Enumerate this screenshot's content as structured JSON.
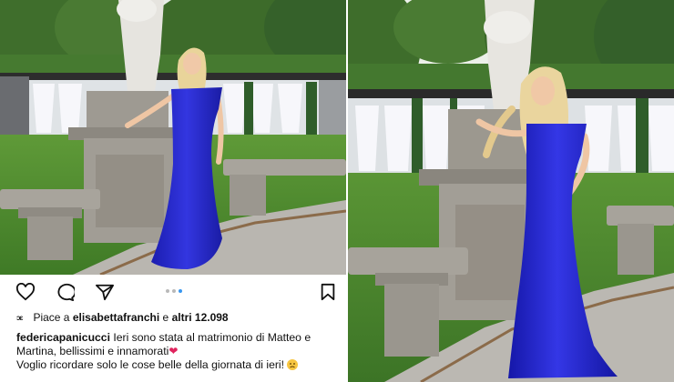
{
  "post": {
    "liked_by_prefix": "Piace a",
    "liked_by_user": "elisabettafranchi",
    "liked_by_connector": "e",
    "liked_by_others": "altri 12.098",
    "author": "federicapanicucci",
    "caption_line": "Ieri sono stata al matrimonio di Matteo e Martina, bellissimi e innamorati",
    "caption_line2": "Voglio ricordare solo le cose belle della giornata di ieri!"
  },
  "actions": {
    "like_icon": "heart-outline-icon",
    "comment_icon": "comment-bubble-icon",
    "share_icon": "paper-plane-icon",
    "save_icon": "bookmark-icon"
  },
  "carousel": {
    "count": 3,
    "active_index": 2
  },
  "colors": {
    "dress_blue": "#2d2fd4",
    "carousel_active": "#3897f0",
    "heart_emoji": "#e0245e",
    "lawn_green": "#4f8a2f"
  }
}
